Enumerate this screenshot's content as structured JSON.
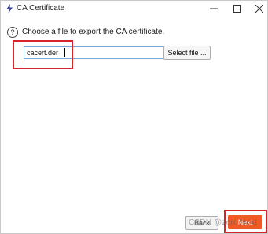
{
  "window": {
    "title": "CA Certificate",
    "icon": "app-logo-icon",
    "controls": [
      "minimize-icon",
      "maximize-icon",
      "close-icon"
    ]
  },
  "help_icon": {
    "glyph": "?"
  },
  "prompt": "Choose a file to export the CA certificate.",
  "file_input": {
    "value": "cacert.der"
  },
  "select_file_label": "Select file ...",
  "back_label": "Back",
  "next_label": "Next",
  "watermark": "CSDN @zero Next",
  "colors": {
    "accent_button": "#f05a24",
    "highlight_box": "#d6252b",
    "input_border": "#7aa6d8"
  }
}
